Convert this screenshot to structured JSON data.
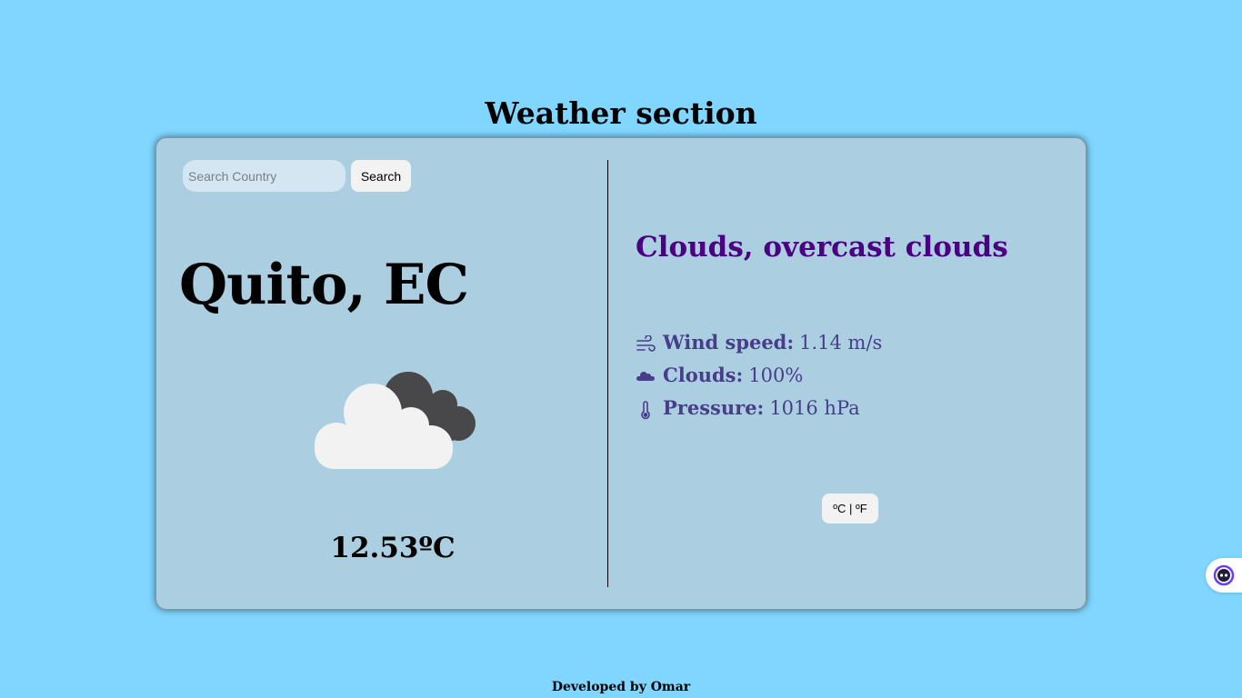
{
  "page": {
    "title": "Weather section",
    "footer": "Developed by Omar"
  },
  "search": {
    "placeholder": "Search Country",
    "value": "",
    "button_label": "Search"
  },
  "location": {
    "city": "Quito, EC"
  },
  "current": {
    "icon": "overcast-clouds-icon",
    "temperature": "12.53ºC",
    "description": "Clouds, overcast clouds"
  },
  "details": [
    {
      "icon": "wind-icon",
      "label": "Wind speed:",
      "value": "1.14 m/s"
    },
    {
      "icon": "cloud-icon",
      "label": "Clouds:",
      "value": "100%"
    },
    {
      "icon": "thermometer-icon",
      "label": "Pressure:",
      "value": "1016 hPa"
    }
  ],
  "unit_toggle": {
    "label": "ºC | ºF"
  },
  "colors": {
    "background": "#80d6ff",
    "card": "#abcfe0",
    "description": "#4b0082",
    "details": "#483d8b"
  }
}
